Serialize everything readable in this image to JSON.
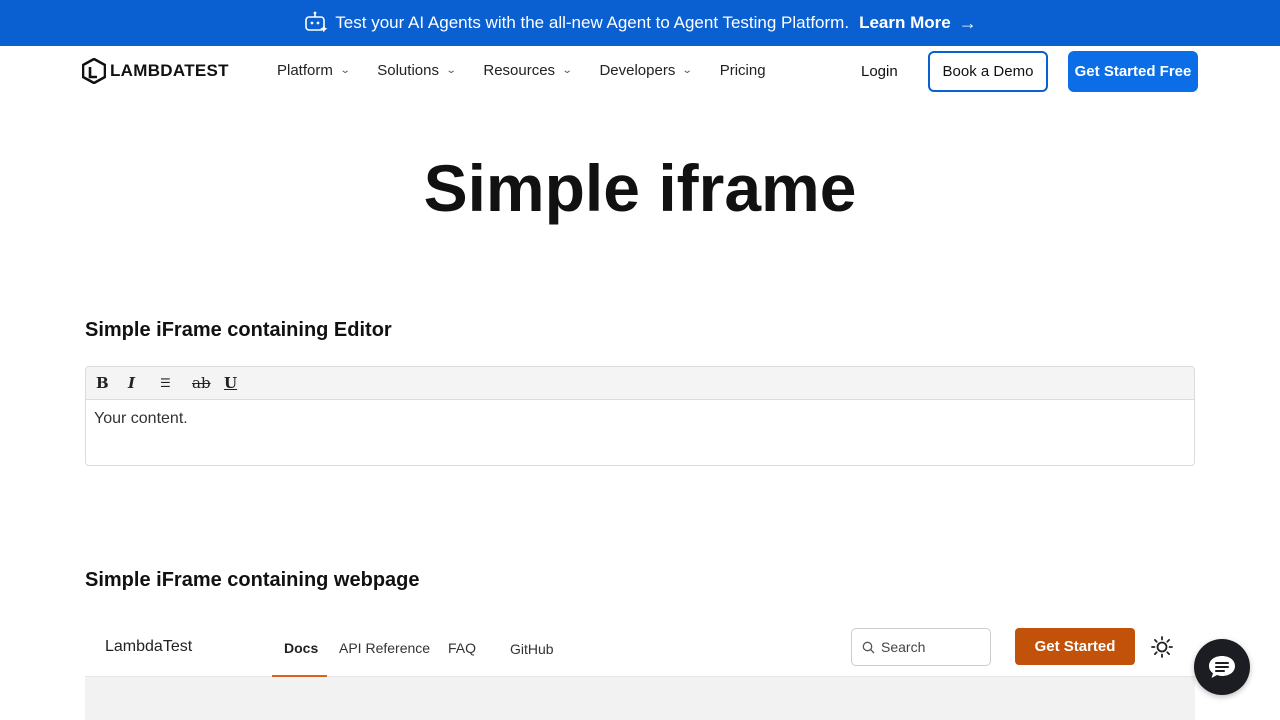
{
  "banner": {
    "text": "Test your AI Agents with the all-new Agent to Agent Testing Platform.",
    "link": "Learn More",
    "icon": "robot-icon",
    "background": "#0a5fd1"
  },
  "header": {
    "logo_text": "LAMBDATEST",
    "nav": [
      {
        "label": "Platform",
        "dropdown": true
      },
      {
        "label": "Solutions",
        "dropdown": true
      },
      {
        "label": "Resources",
        "dropdown": true
      },
      {
        "label": "Developers",
        "dropdown": true
      },
      {
        "label": "Pricing",
        "dropdown": false
      }
    ],
    "login": "Login",
    "book_demo": "Book a Demo",
    "get_started_free": "Get Started Free",
    "accent": "#0b6ee6"
  },
  "page": {
    "title": "Simple iframe",
    "editor_section_title": "Simple iFrame containing Editor",
    "webpage_section_title": "Simple iFrame containing webpage"
  },
  "editor": {
    "tools": [
      {
        "name": "bold",
        "glyph": "B"
      },
      {
        "name": "italic",
        "glyph": "I"
      },
      {
        "name": "list",
        "glyph": "☰"
      },
      {
        "name": "strikethrough",
        "glyph": "ab"
      },
      {
        "name": "underline",
        "glyph": "U"
      }
    ],
    "content": "Your content."
  },
  "embedded": {
    "brand": "LambdaTest",
    "links": [
      "Docs",
      "API Reference",
      "FAQ",
      "GitHub"
    ],
    "active_link": "Docs",
    "search_placeholder": "Search",
    "get_started": "Get Started",
    "accent": "#c2510a"
  },
  "chat": {
    "icon": "chat-icon"
  }
}
